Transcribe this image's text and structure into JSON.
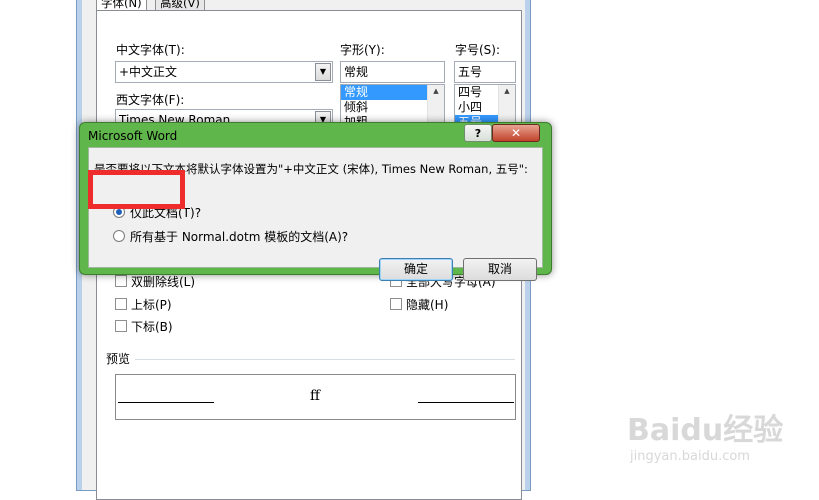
{
  "font_dialog": {
    "tabs": [
      {
        "label": "字体(N)"
      },
      {
        "label": "高级(V)"
      }
    ],
    "chinese_font_label": "中文字体(T):",
    "chinese_font_value": "+中文正文",
    "western_font_label": "西文字体(F):",
    "western_font_value": "Times New Roman",
    "style_label": "字形(Y):",
    "style_value": "常规",
    "style_options": [
      "常规",
      "倾斜",
      "加粗"
    ],
    "size_label": "字号(S):",
    "size_value": "五号",
    "size_options": [
      "四号",
      "小四",
      "五号"
    ],
    "effects_left": [
      {
        "label": "双删除线(L)"
      },
      {
        "label": "上标(P)"
      },
      {
        "label": "下标(B)"
      }
    ],
    "effects_right": [
      {
        "label": "全部大写字母(A)"
      },
      {
        "label": "隐藏(H)"
      }
    ],
    "preview_label": "预览",
    "preview_text": "ff"
  },
  "message_box": {
    "title": "Microsoft Word",
    "help_label": "?",
    "close_label": "✕",
    "question": "是否要将以下文本将默认字体设置为\"+中文正文 (宋体), Times New Roman, 五号\":",
    "option_current_doc": "仅此文档(T)?",
    "option_all_docs": "所有基于 Normal.dotm 模板的文档(A)?",
    "selected_option": "option_current_doc",
    "ok_label": "确定",
    "cancel_label": "取消"
  },
  "watermark": {
    "brand": "Baidu经验",
    "url": "jingyan.baidu.com"
  },
  "colors": {
    "dialog_frame_green": "#5fb64a",
    "highlight_red": "#ee2c2c",
    "selection_blue": "#3399ff"
  }
}
